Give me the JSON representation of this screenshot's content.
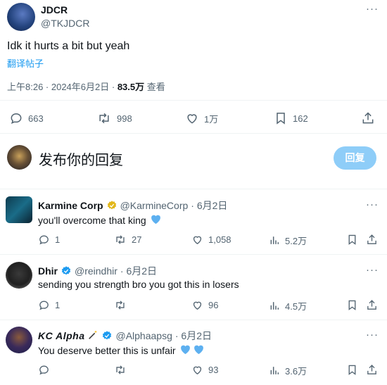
{
  "main_post": {
    "author_name": "JDCR",
    "author_handle": "@TKJDCR",
    "text": "Idk it hurts a bit but yeah",
    "translate_label": "翻译帖子",
    "time": "上午8:26 · 2024年6月2日 ·",
    "views_count": "83.5万",
    "views_label": "查看",
    "replies": "663",
    "retweets": "998",
    "likes": "1万",
    "bookmarks": "162"
  },
  "compose": {
    "placeholder": "发布你的回复",
    "reply_button": "回复"
  },
  "replies": [
    {
      "name": "Karmine Corp",
      "handle": "@KarmineCorp",
      "date": "· 6月2日",
      "text": "you'll overcome that king",
      "replies": "1",
      "retweets": "27",
      "likes": "1,058",
      "views": "5.2万"
    },
    {
      "name": "Dhir",
      "handle": "@reindhir",
      "date": "· 6月2日",
      "text": "sending you strength bro you got this in losers",
      "replies": "1",
      "retweets": "",
      "likes": "96",
      "views": "4.5万"
    },
    {
      "name": "KC Alpha",
      "handle": "@Alphaapsg",
      "date": "· 6月2日",
      "text": "You deserve better this is unfair",
      "replies": "",
      "retweets": "",
      "likes": "93",
      "views": "3.6万"
    }
  ],
  "colors": {
    "accent": "#1d9bf0",
    "reply_button_bg": "#8ecdf8",
    "gold_badge": "#e2b719",
    "heart_emoji": "#5db0f0"
  },
  "icons": [
    "more-icon",
    "reply-icon",
    "retweet-icon",
    "like-icon",
    "bookmark-icon",
    "share-icon",
    "views-icon",
    "verified-icon",
    "gold-verified-icon",
    "wand-emoji",
    "blue-heart-emoji"
  ]
}
